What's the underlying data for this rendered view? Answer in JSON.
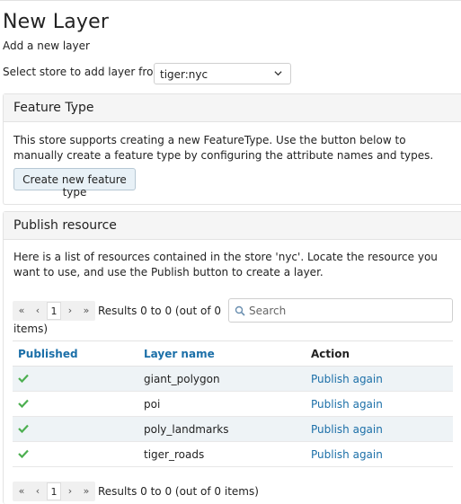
{
  "header": {
    "title": "New Layer",
    "subtitle": "Add a new layer"
  },
  "store": {
    "label": "Select store to add layer from",
    "selected": "tiger:nyc"
  },
  "feature_type": {
    "heading": "Feature Type",
    "description": "This store supports creating a new FeatureType. Use the button below to manually create a feature type by configuring the attribute names and types.",
    "button_label": "Create new feature type"
  },
  "publish": {
    "heading": "Publish resource",
    "description": "Here is a list of resources contained in the store 'nyc'. Locate the resource you want to use, and use the Publish button to create a layer.",
    "pager_top": {
      "first": "«",
      "prev": "‹",
      "page": "1",
      "next": "›",
      "last": "»",
      "results_line1": "Results 0 to 0 (out of 0",
      "results_line2": "items)"
    },
    "search_placeholder": "Search",
    "columns": [
      "Published",
      "Layer name",
      "Action"
    ],
    "rows": [
      {
        "layer_name": "giant_polygon",
        "action": "Publish again"
      },
      {
        "layer_name": "poi",
        "action": "Publish again"
      },
      {
        "layer_name": "poly_landmarks",
        "action": "Publish again"
      },
      {
        "layer_name": "tiger_roads",
        "action": "Publish again"
      }
    ],
    "pager_bottom": {
      "first": "«",
      "prev": "‹",
      "page": "1",
      "next": "›",
      "last": "»",
      "results": "Results 0 to 0 (out of 0 items)"
    }
  },
  "colors": {
    "link": "#1b6fa8",
    "check": "#4caf50",
    "row_stripe": "#eef3f6"
  },
  "icons": {
    "published": "check-icon",
    "search": "search-icon",
    "select": "chevron-down-icon"
  }
}
